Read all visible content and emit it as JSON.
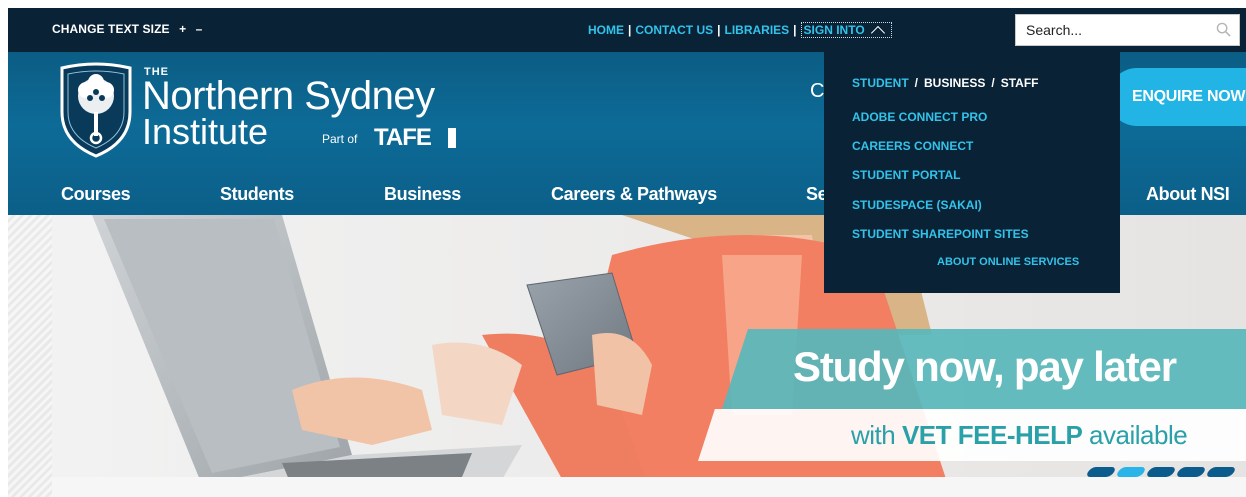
{
  "topbar": {
    "text_size_label": "CHANGE TEXT SIZE",
    "increase": "+",
    "decrease": "–",
    "links": [
      "HOME",
      "CONTACT US",
      "LIBRARIES"
    ],
    "sign_into": "SIGN INTO",
    "search_placeholder": "Search..."
  },
  "header": {
    "logo": {
      "the": "THE",
      "name_line1": "Northern Sydney",
      "name_line2": "Institute",
      "part_of": "Part of",
      "tafe": "TAFE"
    },
    "partial_text": "C",
    "enquire": "ENQUIRE NOW"
  },
  "nav": {
    "items": [
      "Courses",
      "Students",
      "Business",
      "Careers & Pathways",
      "Se",
      "About NSI"
    ]
  },
  "dropdown": {
    "tabs": [
      "STUDENT",
      "BUSINESS",
      "STAFF"
    ],
    "active_tab": "STUDENT",
    "items": [
      "ADOBE CONNECT PRO",
      "CAREERS CONNECT",
      "STUDENT PORTAL",
      "STUDESPACE (SAKAI)",
      "STUDENT SHAREPOINT SITES"
    ],
    "about": "ABOUT ONLINE SERVICES"
  },
  "hero": {
    "headline": "Study now, pay later",
    "sub_prefix": "with ",
    "sub_bold": "VET FEE-HELP",
    "sub_suffix": " available",
    "slide_count": 5,
    "active_slide": 2
  },
  "colors": {
    "topbar": "#0a2236",
    "header": "#0d6b97",
    "accent": "#32c3ea",
    "enquire": "#22b4e4",
    "promo": "#58b7bb"
  }
}
